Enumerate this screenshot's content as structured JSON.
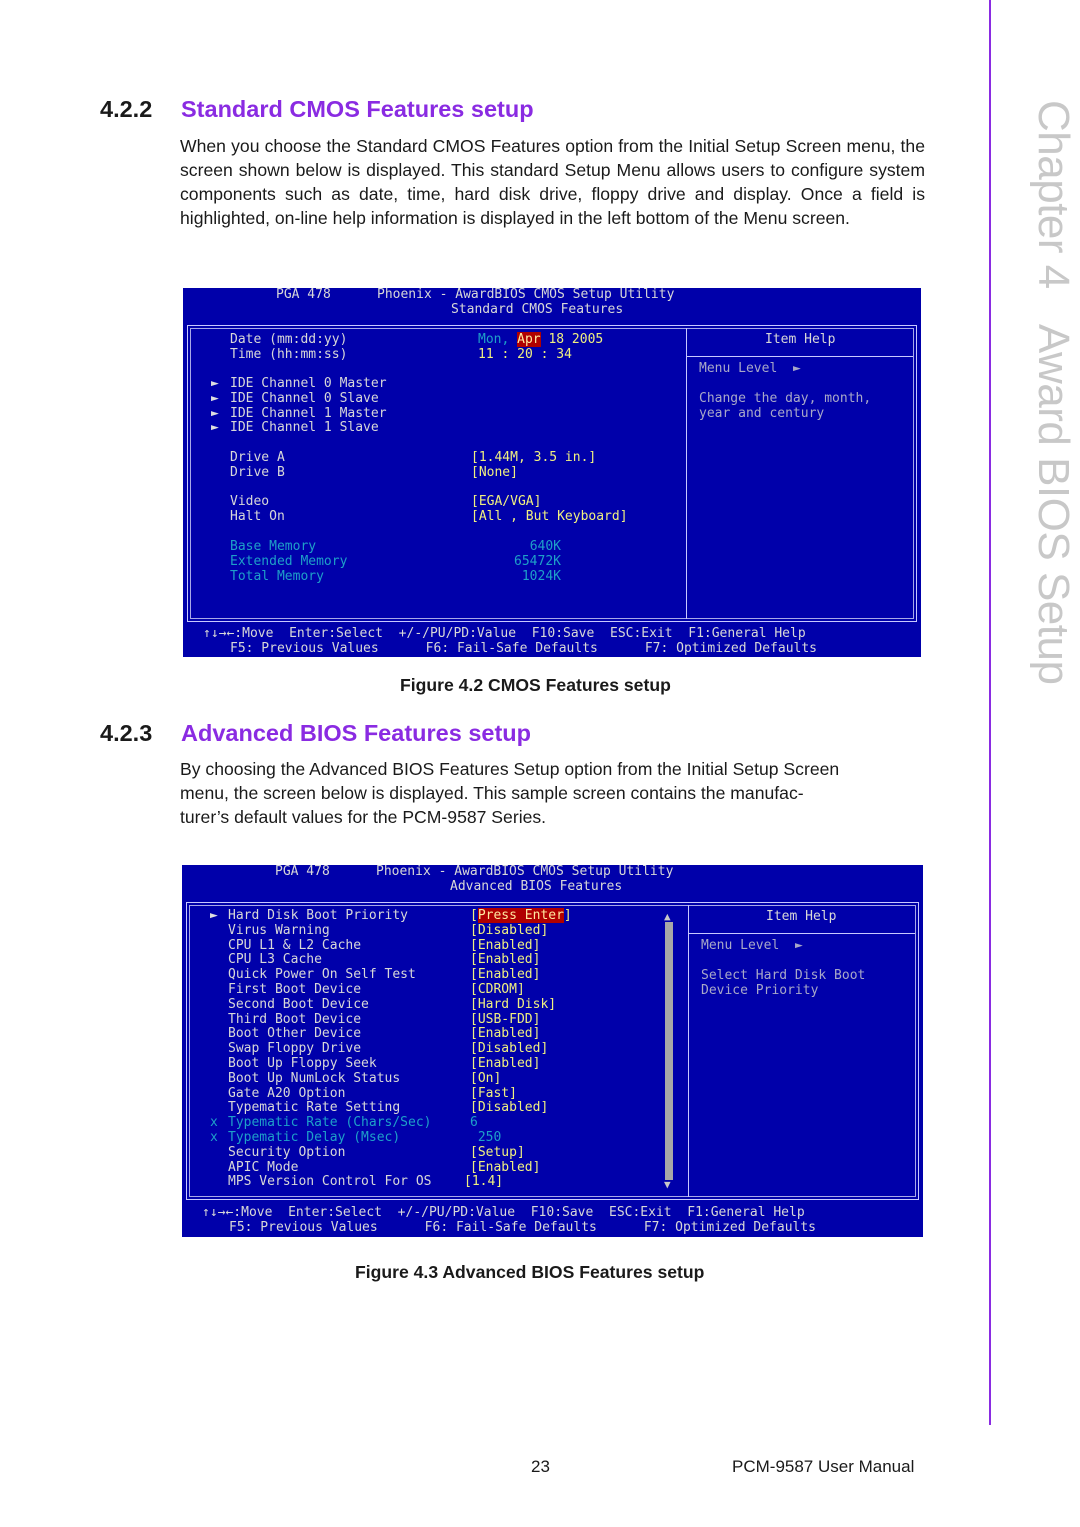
{
  "side": {
    "chapter": "Chapter 4",
    "chapter_title": "Award BIOS Setup"
  },
  "sections": [
    {
      "number": "4.2.2",
      "title": "Standard CMOS Features setup",
      "paragraph": "When you choose the Standard CMOS Features option from the Initial Setup Screen menu, the screen shown below is displayed. This standard Setup Menu allows users to configure system components such as date, time, hard disk drive, floppy drive and display. Once a field is highlighted, on-line help information is displayed in the left bottom of the Menu screen.",
      "caption": "Figure 4.2 CMOS Features setup"
    },
    {
      "number": "4.2.3",
      "title": "Advanced BIOS Features setup",
      "paragraph_lines": [
        "By choosing the Advanced BIOS Features Setup option from the Initial Setup Screen",
        "menu, the screen below is displayed. This sample screen contains the manufac-",
        "turer’s default values for the PCM-9587 Series."
      ],
      "caption": "Figure 4.3 Advanced BIOS Features setup"
    }
  ],
  "bios_cmos": {
    "header_left": "PGA 478",
    "header_title": "Phoenix - AwardBIOS CMOS Setup Utility",
    "header_subtitle": "Standard CMOS Features",
    "date_label": "Date (mm:dd:yy)",
    "date_day": "Mon,",
    "date_month": "Apr",
    "date_rest": "18 2005",
    "time_label": "Time (hh:mm:ss)",
    "time_value": "11 : 20 : 34",
    "submenus": [
      "IDE Channel 0 Master",
      "IDE Channel 0 Slave",
      "IDE Channel 1 Master",
      "IDE Channel 1 Slave"
    ],
    "settings": [
      {
        "label": "Drive A",
        "value": "[1.44M, 3.5 in.]"
      },
      {
        "label": "Drive B",
        "value": "[None]"
      },
      {
        "label": "Video",
        "value": "[EGA/VGA]"
      },
      {
        "label": "Halt On",
        "value": "[All , But Keyboard]"
      }
    ],
    "memory": [
      {
        "label": "Base Memory",
        "value": "640K"
      },
      {
        "label": "Extended Memory",
        "value": "65472K"
      },
      {
        "label": "Total Memory",
        "value": "1024K"
      }
    ],
    "help_title": "Item Help",
    "menu_level": "Menu Level",
    "help_lines": [
      "Change the day, month,",
      "year and century"
    ],
    "footer_line1": "↑↓→←:Move  Enter:Select  +/-/PU/PD:Value  F10:Save  ESC:Exit  F1:General Help",
    "footer_line2": "F5: Previous Values      F6: Fail-Safe Defaults      F7: Optimized Defaults"
  },
  "bios_adv": {
    "header_left": "PGA 478",
    "header_title": "Phoenix - AwardBIOS CMOS Setup Utility",
    "header_subtitle": "Advanced BIOS Features",
    "items": [
      {
        "marker": "►",
        "label": "Hard Disk Boot Priority",
        "value_open": "[",
        "value": "Press Enter",
        "value_close": "]",
        "highlight": true
      },
      {
        "marker": "",
        "label": "Virus Warning",
        "value": "[Disabled]"
      },
      {
        "marker": "",
        "label": "CPU L1 & L2 Cache",
        "value": "[Enabled]"
      },
      {
        "marker": "",
        "label": "CPU L3 Cache",
        "value": "[Enabled]"
      },
      {
        "marker": "",
        "label": "Quick Power On Self Test",
        "value": "[Enabled]"
      },
      {
        "marker": "",
        "label": "First Boot Device",
        "value": "[CDROM]"
      },
      {
        "marker": "",
        "label": "Second Boot Device",
        "value": "[Hard Disk]"
      },
      {
        "marker": "",
        "label": "Third Boot Device",
        "value": "[USB-FDD]"
      },
      {
        "marker": "",
        "label": "Boot Other Device",
        "value": "[Enabled]"
      },
      {
        "marker": "",
        "label": "Swap Floppy Drive",
        "value": "[Disabled]"
      },
      {
        "marker": "",
        "label": "Boot Up Floppy Seek",
        "value": "[Enabled]"
      },
      {
        "marker": "",
        "label": "Boot Up NumLock Status",
        "value": "[On]"
      },
      {
        "marker": "",
        "label": "Gate A20 Option",
        "value": "[Fast]"
      },
      {
        "marker": "",
        "label": "Typematic Rate Setting",
        "value": "[Disabled]"
      },
      {
        "marker": "x",
        "label": "Typematic Rate (Chars/Sec)",
        "value": "6",
        "disabled": true
      },
      {
        "marker": "x",
        "label": "Typematic Delay (Msec)",
        "value": " 250",
        "disabled": true
      },
      {
        "marker": "",
        "label": "Security Option",
        "value": "[Setup]"
      },
      {
        "marker": "",
        "label": "APIC Mode",
        "value": "[Enabled]"
      },
      {
        "marker": "",
        "label": "MPS Version Control For OS",
        "value": "[1.4]"
      }
    ],
    "help_title": "Item Help",
    "menu_level": "Menu Level",
    "help_lines": [
      "Select Hard Disk Boot",
      "Device Priority"
    ],
    "footer_line1": "↑↓→←:Move  Enter:Select  +/-/PU/PD:Value  F10:Save  ESC:Exit  F1:General Help",
    "footer_line2": "F5: Previous Values      F6: Fail-Safe Defaults      F7: Optimized Defaults"
  },
  "footer": {
    "page_number": "23",
    "manual": "PCM-9587 User Manual"
  }
}
